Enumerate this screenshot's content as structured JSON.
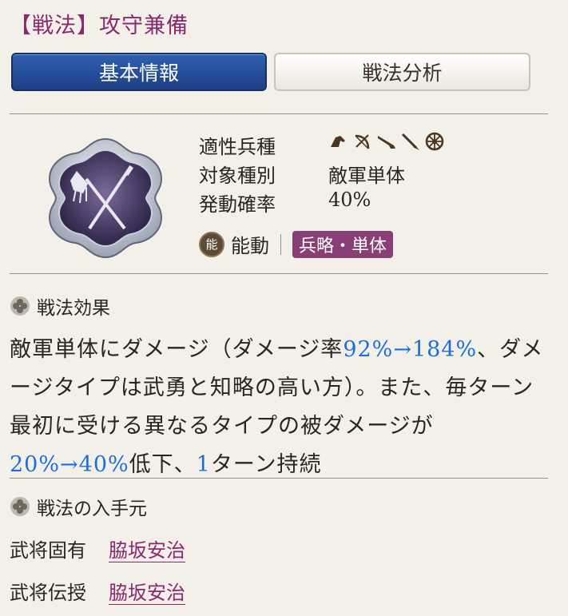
{
  "title": "【戦法】攻守兼備",
  "tabs": [
    {
      "label": "基本情報",
      "active": true
    },
    {
      "label": "戦法分析",
      "active": false
    }
  ],
  "info": {
    "troop_label": "適性兵種",
    "troop_icons": [
      "cavalry-icon",
      "bow-icon",
      "gun-icon",
      "spear-icon",
      "wheel-icon"
    ],
    "target_label": "対象種別",
    "target_value": "敵軍単体",
    "rate_label": "発動確率",
    "rate_value": "40%"
  },
  "type_line": {
    "badge": "能",
    "kind": "能動",
    "tag": "兵略・単体"
  },
  "effect_section": {
    "heading": "戦法効果",
    "segments": [
      {
        "text": "敵軍単体にダメージ（ダメージ率",
        "highlight": false
      },
      {
        "text": "92%→184%",
        "highlight": true
      },
      {
        "text": "、ダメージタイプは武勇と知略の高い方）。また、毎ターン最初に受ける異なるタイプの被ダメージが",
        "highlight": false
      },
      {
        "text": "20%→40%",
        "highlight": true
      },
      {
        "text": "低下、",
        "highlight": false
      },
      {
        "text": "1",
        "highlight": true
      },
      {
        "text": "ターン持続",
        "highlight": false
      }
    ]
  },
  "source_section": {
    "heading": "戦法の入手元",
    "rows": [
      {
        "label": "武将固有",
        "value": "脇坂安治"
      },
      {
        "label": "武将伝授",
        "value": "脇坂安治"
      }
    ]
  },
  "colors": {
    "title": "#8a2a6e",
    "tab_active": "#2a559f",
    "highlight": "#1c6fd8",
    "tag_bg": "#8a3e76"
  }
}
